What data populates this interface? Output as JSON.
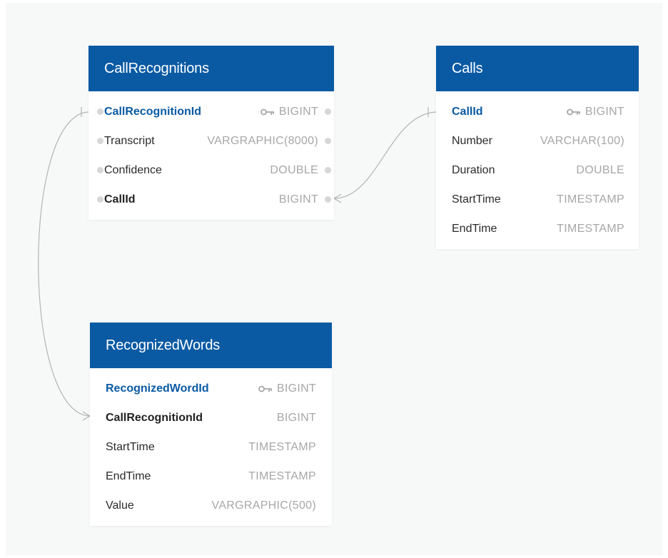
{
  "colors": {
    "header_bg": "#0a5aa3",
    "pk_text": "#0a5aa3",
    "type_text": "#a7a7a7",
    "canvas_bg": "#f7f8f8",
    "connector": "#b4b4b4"
  },
  "tables": {
    "call_recognitions": {
      "title": "CallRecognitions",
      "columns": [
        {
          "name": "CallRecognitionId",
          "type": "BIGINT",
          "key": "primary"
        },
        {
          "name": "Transcript",
          "type": "VARGRAPHIC(8000)",
          "key": "none"
        },
        {
          "name": "Confidence",
          "type": "DOUBLE",
          "key": "none"
        },
        {
          "name": "CallId",
          "type": "BIGINT",
          "key": "foreign"
        }
      ]
    },
    "calls": {
      "title": "Calls",
      "columns": [
        {
          "name": "CallId",
          "type": "BIGINT",
          "key": "primary"
        },
        {
          "name": "Number",
          "type": "VARCHAR(100)",
          "key": "none"
        },
        {
          "name": "Duration",
          "type": "DOUBLE",
          "key": "none"
        },
        {
          "name": "StartTime",
          "type": "TIMESTAMP",
          "key": "none"
        },
        {
          "name": "EndTime",
          "type": "TIMESTAMP",
          "key": "none"
        }
      ]
    },
    "recognized_words": {
      "title": "RecognizedWords",
      "columns": [
        {
          "name": "RecognizedWordId",
          "type": "BIGINT",
          "key": "primary"
        },
        {
          "name": "CallRecognitionId",
          "type": "BIGINT",
          "key": "foreign"
        },
        {
          "name": "StartTime",
          "type": "TIMESTAMP",
          "key": "none"
        },
        {
          "name": "EndTime",
          "type": "TIMESTAMP",
          "key": "none"
        },
        {
          "name": "Value",
          "type": "VARGRAPHIC(500)",
          "key": "none"
        }
      ]
    }
  },
  "relationships": [
    {
      "from": "call_recognitions.CallId",
      "to": "calls.CallId",
      "type": "many-to-one"
    },
    {
      "from": "recognized_words.CallRecognitionId",
      "to": "call_recognitions.CallRecognitionId",
      "type": "many-to-one"
    }
  ],
  "icons": {
    "primary_key": "key-icon",
    "connector_end": "crows-foot-icon"
  }
}
